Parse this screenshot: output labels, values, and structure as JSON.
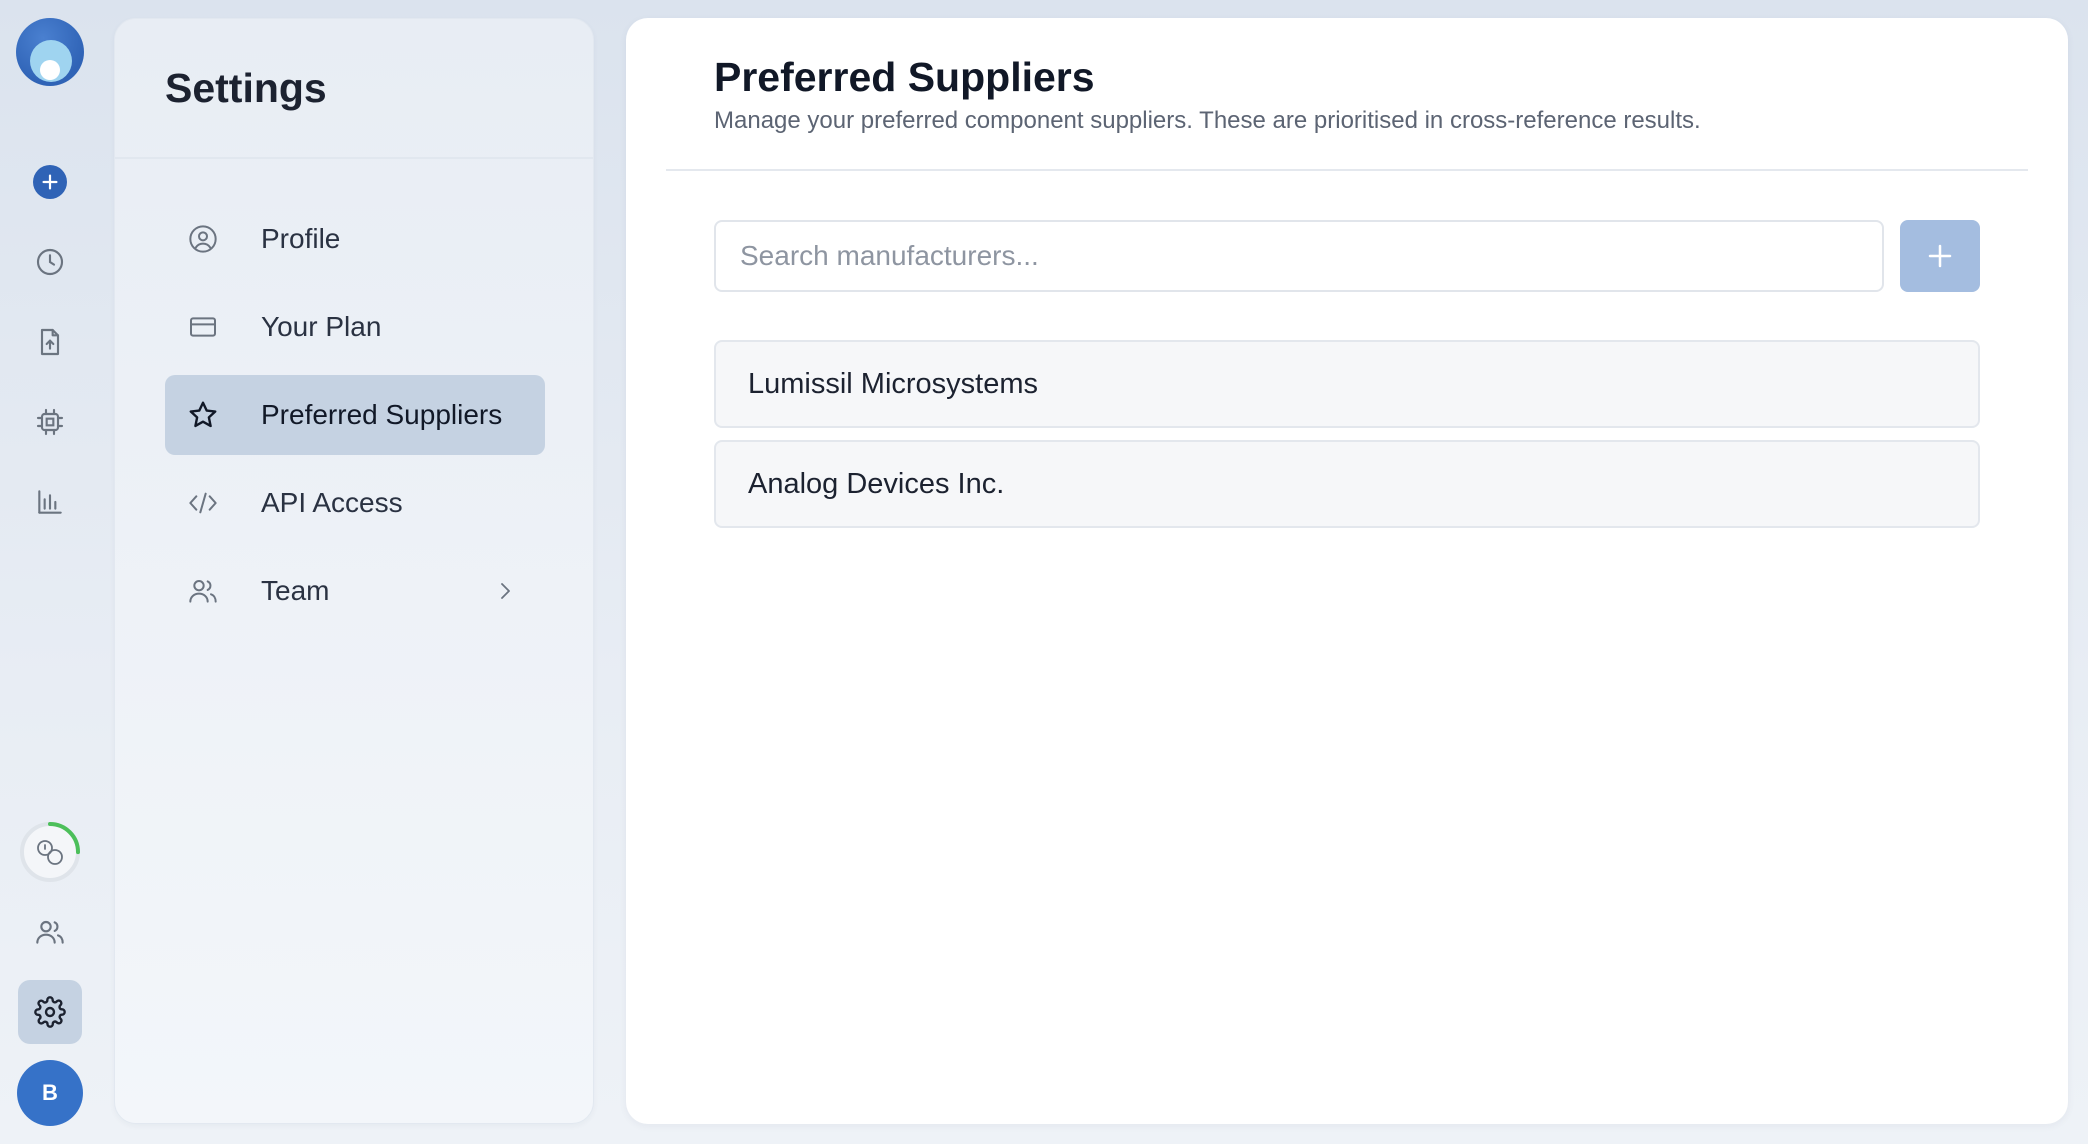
{
  "rail": {
    "avatar_initial": "B",
    "items": [
      {
        "name": "new",
        "icon": "plus-icon"
      },
      {
        "name": "history",
        "icon": "clock-icon"
      },
      {
        "name": "upload",
        "icon": "file-upload-icon"
      },
      {
        "name": "components",
        "icon": "chip-icon"
      },
      {
        "name": "analytics",
        "icon": "bar-chart-icon"
      },
      {
        "name": "usage",
        "icon": "usage-progress-icon"
      },
      {
        "name": "team",
        "icon": "users-icon"
      },
      {
        "name": "settings",
        "icon": "gear-icon",
        "active": true
      }
    ],
    "usage_progress": 0.25
  },
  "settings": {
    "title": "Settings",
    "nav": [
      {
        "label": "Profile",
        "icon": "user-circle-icon"
      },
      {
        "label": "Your Plan",
        "icon": "credit-card-icon"
      },
      {
        "label": "Preferred Suppliers",
        "icon": "star-icon",
        "active": true
      },
      {
        "label": "API Access",
        "icon": "code-icon"
      },
      {
        "label": "Team",
        "icon": "users-icon",
        "has_chevron": true
      }
    ]
  },
  "main": {
    "title": "Preferred Suppliers",
    "subtitle": "Manage your preferred component suppliers. These are prioritised in cross-reference results.",
    "search": {
      "placeholder": "Search manufacturers...",
      "value": ""
    },
    "suppliers": [
      {
        "name": "Lumissil Microsystems"
      },
      {
        "name": "Analog Devices Inc."
      }
    ]
  },
  "colors": {
    "accent": "#2f63b6",
    "active_bg": "#c5d2e2",
    "add_button": "#a4bde0",
    "progress_ring": "#4cbf5a"
  }
}
